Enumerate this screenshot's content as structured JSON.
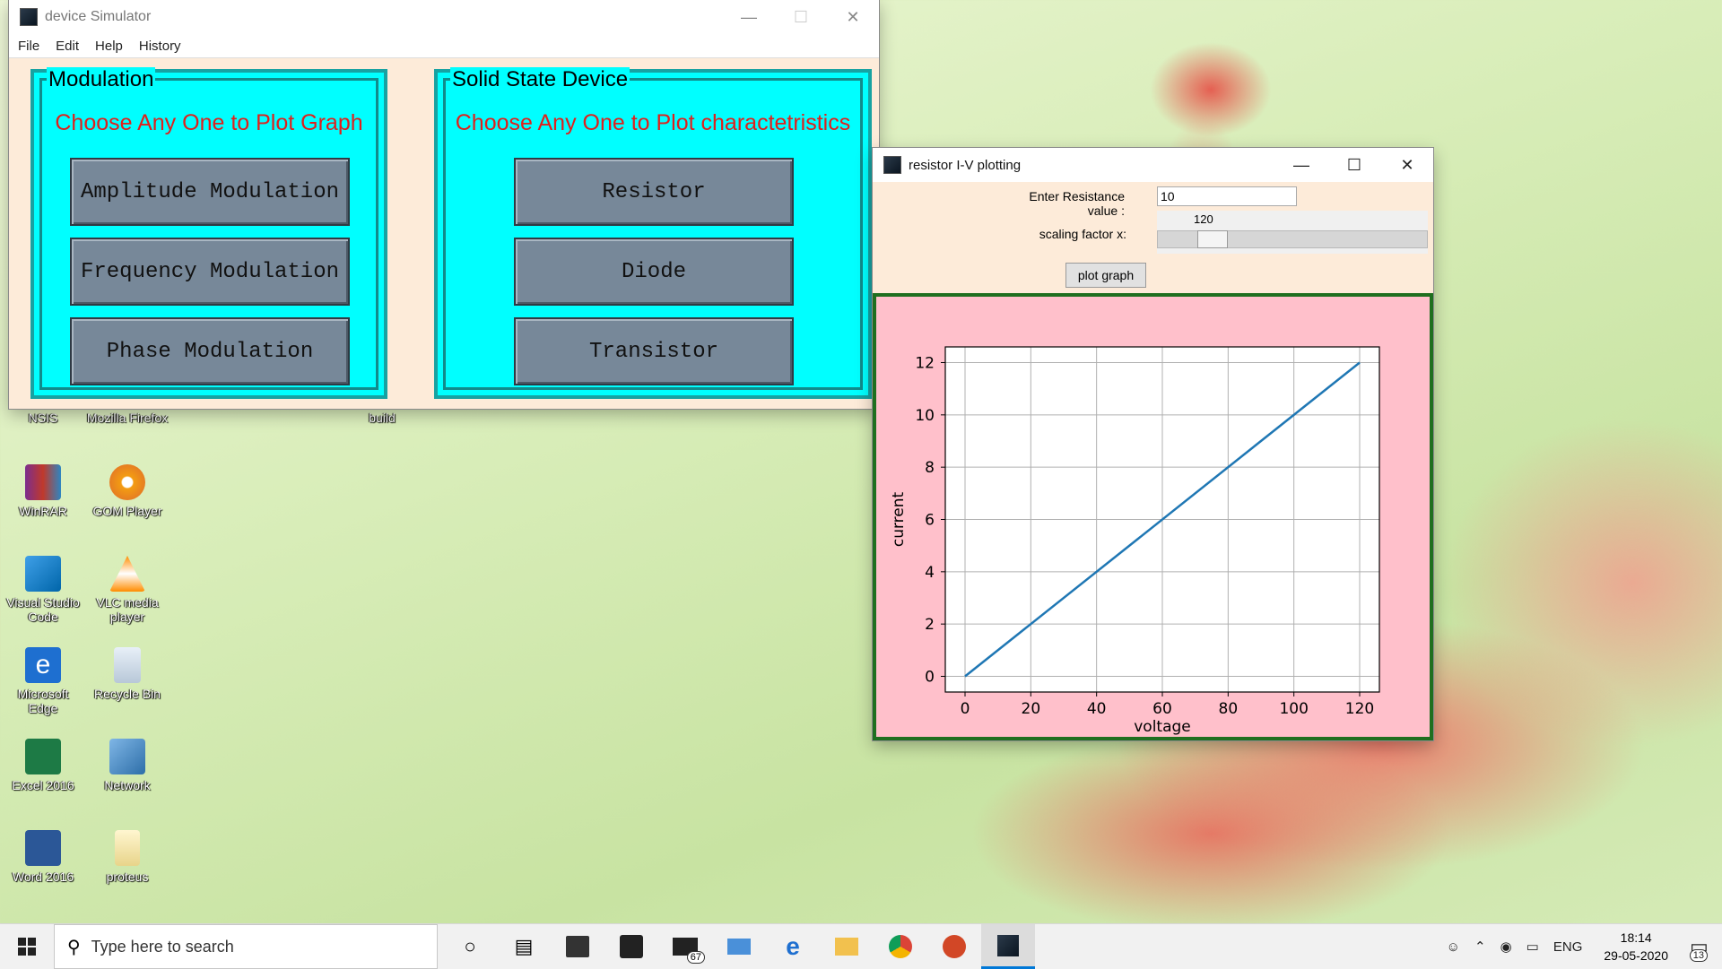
{
  "desktop_icons": [
    {
      "label": "NSIS"
    },
    {
      "label": "Mozilla Firefox"
    },
    {
      "label": "build"
    },
    {
      "label": "WinRAR"
    },
    {
      "label": "GOM Player"
    },
    {
      "label": "Visual Studio Code"
    },
    {
      "label": "VLC media player"
    },
    {
      "label": "Microsoft Edge"
    },
    {
      "label": "Recycle Bin"
    },
    {
      "label": "Excel 2016"
    },
    {
      "label": "Network"
    },
    {
      "label": "Word 2016"
    },
    {
      "label": "proteus"
    }
  ],
  "main_window": {
    "title": "device Simulator",
    "menu": [
      "File",
      "Edit",
      "Help",
      "History"
    ],
    "modulation": {
      "title": "Modulation",
      "subtitle": "Choose Any One to Plot Graph",
      "buttons": [
        "Amplitude Modulation",
        "Frequency Modulation",
        "Phase Modulation"
      ]
    },
    "solid_state": {
      "title": "Solid State Device",
      "subtitle": "Choose Any One to Plot charactetristics",
      "buttons": [
        "Resistor",
        "Diode",
        "Transistor"
      ]
    }
  },
  "plot_window": {
    "title": "resistor I-V plotting",
    "resistance_label": "Enter Resistance value :",
    "resistance_value": "10",
    "scale_label": "scaling factor x:",
    "scale_value": "120",
    "scale_fraction": 0.17,
    "plot_button": "plot graph"
  },
  "chart_data": {
    "type": "line",
    "x": [
      0,
      120
    ],
    "y": [
      0,
      12
    ],
    "xlabel": "voltage",
    "ylabel": "current",
    "xticks": [
      0,
      20,
      40,
      60,
      80,
      100,
      120
    ],
    "yticks": [
      0,
      2,
      4,
      6,
      8,
      10,
      12
    ],
    "xlim": [
      -6,
      126
    ],
    "ylim": [
      -0.6,
      12.6
    ],
    "grid": true,
    "line_color": "#1f77b4"
  },
  "taskbar": {
    "search_placeholder": "Type here to search",
    "mail_badge": "67",
    "lang": "ENG",
    "time": "18:14",
    "date": "29-05-2020",
    "notification_count": "13"
  }
}
